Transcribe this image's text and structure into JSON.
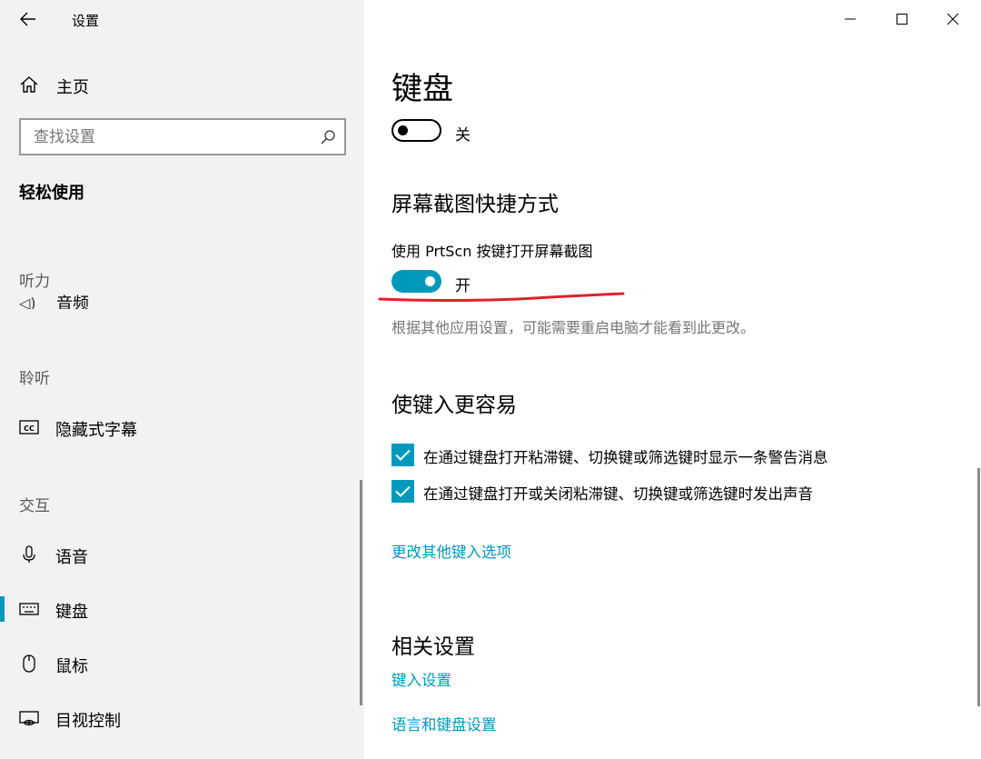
{
  "window": {
    "title": "设置"
  },
  "sidebar": {
    "home_label": "主页",
    "search_placeholder": "查找设置",
    "category": "轻松使用",
    "clipped_item_label": "音频",
    "groups": {
      "hearing": "听力",
      "listening": "聆听",
      "interaction": "交互"
    },
    "items": {
      "captions": "隐藏式字幕",
      "speech": "语音",
      "keyboard": "键盘",
      "mouse": "鼠标",
      "eye_control": "目视控制"
    },
    "selected_item": "键盘"
  },
  "content": {
    "page_title": "键盘",
    "top_toggle": {
      "state_label": "关",
      "on": false
    },
    "screenshot_section": {
      "title": "屏幕截图快捷方式",
      "setting_label": "使用 PrtScn 按键打开屏幕截图",
      "toggle": {
        "state_label": "开",
        "on": true
      },
      "hint": "根据其他应用设置，可能需要重启电脑才能看到此更改。"
    },
    "typing_section": {
      "title": "使键入更容易",
      "checkboxes": [
        {
          "label": "在通过键盘打开粘滞键、切换键或筛选键时显示一条警告消息",
          "checked": true
        },
        {
          "label": "在通过键盘打开或关闭粘滞键、切换键或筛选键时发出声音",
          "checked": true
        }
      ],
      "link": "更改其他键入选项"
    },
    "related_section": {
      "title": "相关设置",
      "links": [
        "键入设置",
        "语言和键盘设置"
      ]
    }
  },
  "colors": {
    "accent": "#0099bc",
    "sidebar_bg": "#f2f2f2",
    "annotation": "#e0202a",
    "hint_text": "#767676"
  },
  "icons": {
    "back": "back-arrow-icon",
    "home": "home-icon",
    "search": "search-icon",
    "captions": "cc-icon",
    "speech": "microphone-icon",
    "keyboard": "keyboard-icon",
    "mouse": "mouse-icon",
    "eye_control": "eye-control-icon",
    "minimize": "minimize-icon",
    "maximize": "maximize-icon",
    "close": "close-icon"
  }
}
